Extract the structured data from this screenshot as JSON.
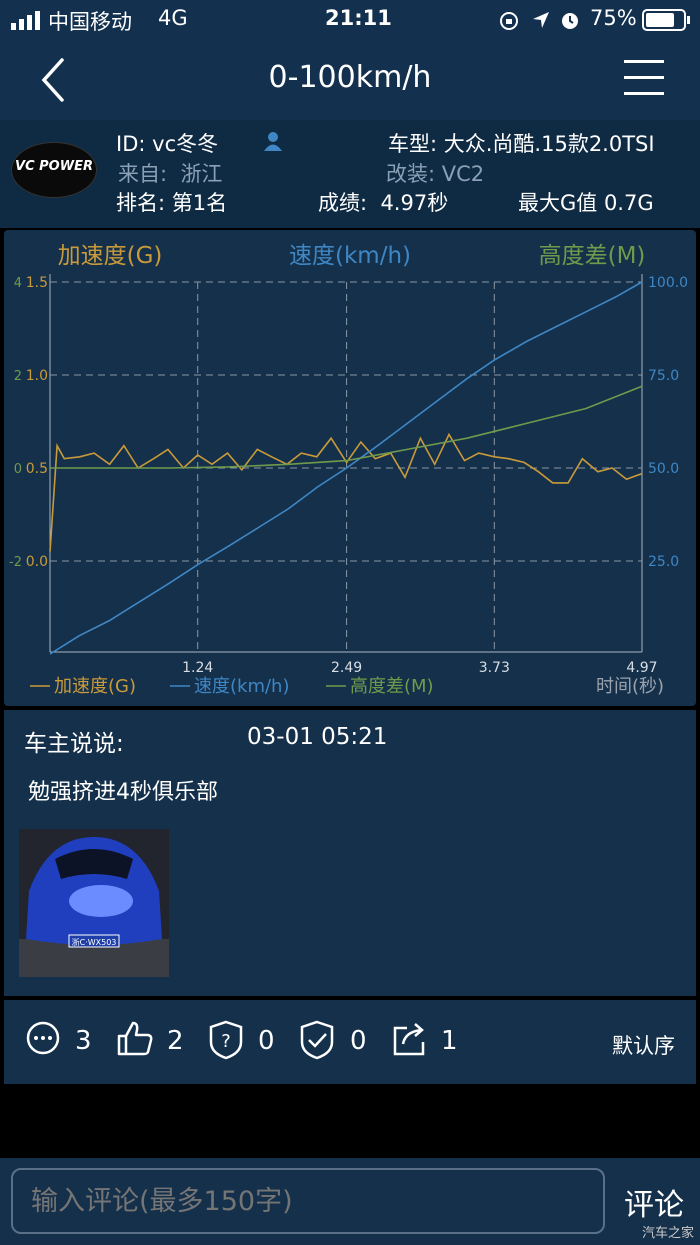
{
  "status": {
    "carrier": "中国移动",
    "network": "4G",
    "time": "21:11",
    "battery": "75%"
  },
  "nav": {
    "title": "0-100km/h",
    "back_icon": "chevron-left-icon",
    "menu_icon": "hamburger-menu-icon"
  },
  "profile": {
    "logo_text": "VC POWER",
    "id_label": "ID:",
    "id_value": "vc冬冬",
    "from_label": "来自:",
    "from_value": "浙江",
    "rank": "排名: 第1名",
    "car": "车型: 大众.尚酷.15款2.0TSI",
    "mod": "改装: VC2",
    "score_label": "成绩:",
    "score_value": "4.97秒",
    "maxg": "最大G值 0.7G"
  },
  "chart_data": {
    "type": "line",
    "headers": [
      "加速度(G)",
      "速度(km/h)",
      "高度差(M)"
    ],
    "x_ticks": [
      "1.24",
      "2.49",
      "3.73",
      "4.97"
    ],
    "x_label": "时间(秒)",
    "xlim": [
      0,
      4.97
    ],
    "left_axis_outer_ticks": [
      "4",
      "2",
      "0",
      "-2"
    ],
    "left_axis_inner_ticks": [
      "1.5",
      "1.0",
      "0.5",
      "0.0"
    ],
    "right_axis_ticks": [
      "100.0",
      "75.0",
      "50.0",
      "25.0"
    ],
    "colors": {
      "accel": "#c99a3a",
      "speed": "#3f87c4",
      "height": "#6f9a4c"
    },
    "series": [
      {
        "name": "加速度(G)",
        "axis": "left_inner",
        "x": [
          0,
          0.06,
          0.12,
          0.25,
          0.37,
          0.5,
          0.62,
          0.74,
          0.87,
          0.99,
          1.12,
          1.24,
          1.36,
          1.49,
          1.61,
          1.74,
          1.86,
          1.99,
          2.11,
          2.24,
          2.36,
          2.49,
          2.61,
          2.73,
          2.86,
          2.98,
          3.11,
          3.23,
          3.35,
          3.48,
          3.6,
          3.73,
          3.85,
          3.98,
          4.1,
          4.22,
          4.35,
          4.47,
          4.6,
          4.72,
          4.84,
          4.97
        ],
        "y": [
          0.05,
          0.62,
          0.55,
          0.56,
          0.58,
          0.52,
          0.62,
          0.5,
          0.55,
          0.6,
          0.5,
          0.57,
          0.52,
          0.58,
          0.49,
          0.6,
          0.56,
          0.52,
          0.58,
          0.56,
          0.66,
          0.53,
          0.64,
          0.55,
          0.58,
          0.45,
          0.66,
          0.52,
          0.68,
          0.54,
          0.58,
          0.56,
          0.55,
          0.53,
          0.48,
          0.42,
          0.42,
          0.55,
          0.48,
          0.5,
          0.44,
          0.47
        ]
      },
      {
        "name": "速度(km/h)",
        "axis": "right",
        "x": [
          0,
          0.25,
          0.5,
          0.75,
          1.0,
          1.24,
          1.5,
          1.75,
          2.0,
          2.25,
          2.49,
          2.75,
          3.0,
          3.25,
          3.5,
          3.73,
          4.0,
          4.25,
          4.5,
          4.75,
          4.97
        ],
        "y": [
          0,
          5,
          9,
          14,
          19,
          24,
          29,
          34,
          39,
          45,
          50,
          56,
          62,
          68,
          74,
          79,
          84,
          88,
          92,
          96,
          100
        ]
      },
      {
        "name": "高度差(M)",
        "axis": "right",
        "x": [
          0,
          0.5,
          1.0,
          1.5,
          2.0,
          2.49,
          3.0,
          3.5,
          4.0,
          4.5,
          4.97
        ],
        "y": [
          50,
          50,
          50,
          50.3,
          51,
          52,
          55,
          58,
          62,
          66,
          72
        ]
      }
    ]
  },
  "comment": {
    "header": "车主说说:",
    "date": "03-01 05:21",
    "text": "勉强挤进4秒俱乐部",
    "photo_plate": "浙C·WX503"
  },
  "actions": {
    "comments": "3",
    "likes": "2",
    "question": "0",
    "verified": "0",
    "shares": "1",
    "sort": "默认序"
  },
  "bottom": {
    "placeholder": "输入评论(最多150字)",
    "submit": "评论",
    "watermark": "汽车之家"
  }
}
